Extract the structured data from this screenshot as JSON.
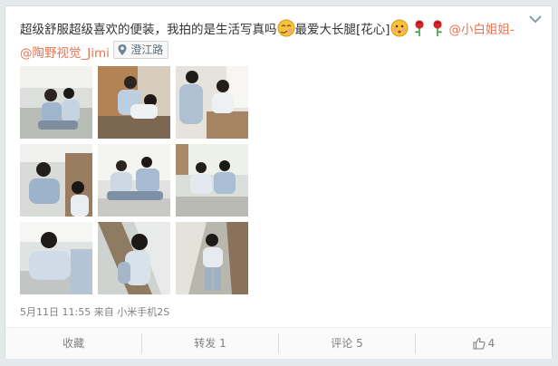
{
  "post": {
    "text_main": "超级舒服超级喜欢的便装，我拍的是生活写真吗",
    "text_mid": "最爱大长腿[花心]",
    "mention_1": "@小白姐姐-",
    "mention_2": "@陶野视觉_Jimi",
    "location": "澄江路",
    "emoji_icons": [
      "shy-face-icon",
      "kiss-face-icon",
      "rose-icon",
      "rose-icon"
    ]
  },
  "meta": {
    "time": "5月11日 11:55",
    "source_prefix": "来自",
    "source": "小米手机2S"
  },
  "actions": {
    "favorite": "收藏",
    "repost": "转发 1",
    "comment": "评论 5",
    "like_count": "4"
  },
  "colors": {
    "link": "#eb7350",
    "meta": "#808080",
    "background": "#e4e9ec"
  }
}
